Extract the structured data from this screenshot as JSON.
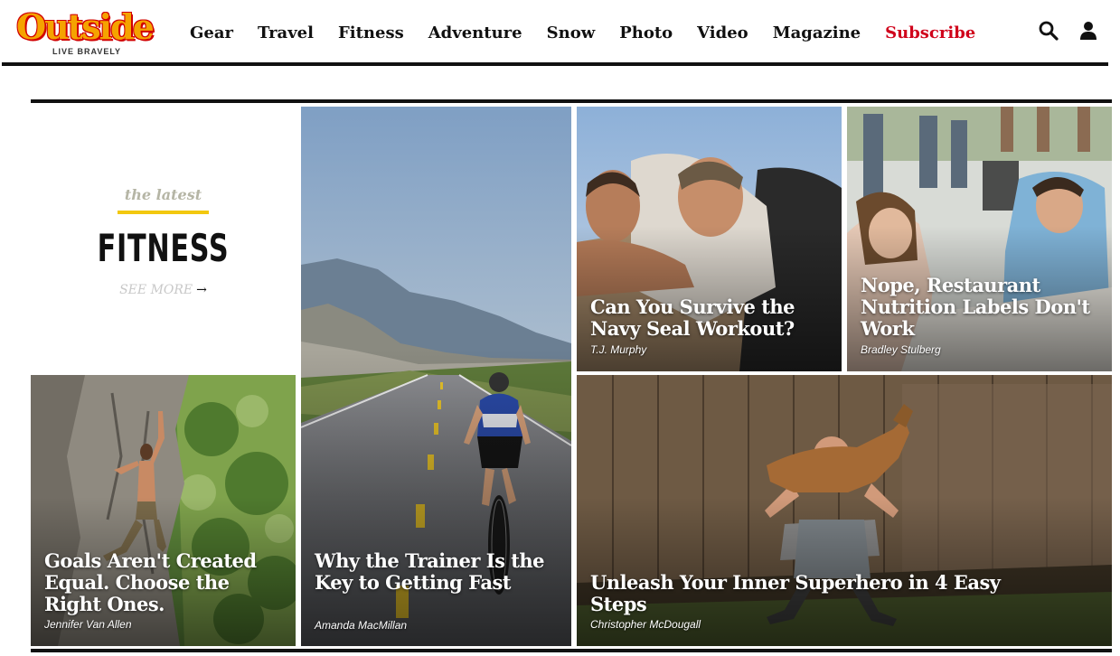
{
  "header": {
    "logo_text": "Outside",
    "logo_tagline": "LIVE BRAVELY",
    "nav": [
      "Gear",
      "Travel",
      "Fitness",
      "Adventure",
      "Snow",
      "Photo",
      "Video",
      "Magazine"
    ],
    "subscribe_label": "Subscribe",
    "icons": [
      "search-icon",
      "user-icon"
    ],
    "colors": {
      "subscribe": "#d0021b",
      "logo": "#f5a300",
      "logo_outline": "#d10000"
    }
  },
  "section": {
    "kicker": "the latest",
    "title": "FITNESS",
    "see_more": "SEE MORE",
    "see_more_arrow": "→",
    "accent": "#f2c80f"
  },
  "cards": [
    {
      "headline": "Why the Trainer Is the Key to Getting Fast",
      "byline": "Amanda MacMillan"
    },
    {
      "headline": "Can You Survive the Navy Seal Workout?",
      "byline": "T.J. Murphy"
    },
    {
      "headline": "Nope, Restaurant Nutrition Labels Don't Work",
      "byline": "Bradley Stulberg"
    },
    {
      "headline": "Goals Aren't Created Equal. Choose the Right Ones.",
      "byline": "Jennifer Van Allen"
    },
    {
      "headline": "Unleash Your Inner Superhero in 4 Easy Steps",
      "byline": "Christopher McDougall"
    }
  ]
}
